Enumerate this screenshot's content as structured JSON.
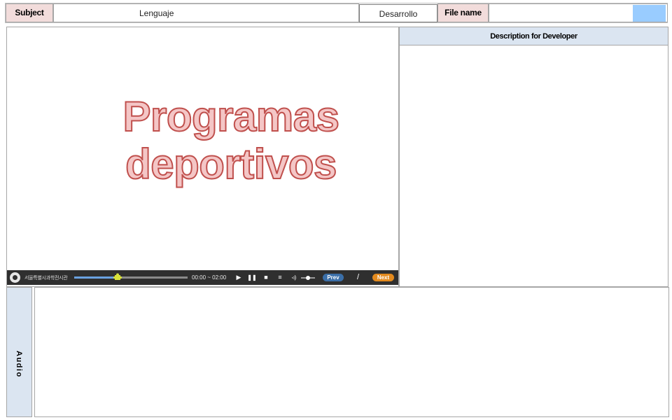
{
  "header": {
    "subject_label": "Subject",
    "subject_value": "Lenguaje",
    "category_value": "Desarrollo",
    "filename_label": "File name",
    "filename_value": ""
  },
  "slide": {
    "title_line1": "Programas",
    "title_line2": "deportivos"
  },
  "player": {
    "brand": "서울특별시과학전시관",
    "time": "00:00 ~ 02:00",
    "progress": 0.38,
    "volume": 0.5,
    "page_indicator": "/",
    "prev_label": "Prev",
    "next_label": "Next",
    "colors": {
      "bar": "#2f2f2f",
      "prev": "#3b6fa8",
      "next": "#e38a1e",
      "progress": "#6aa2e0",
      "handle": "#d8e23a"
    }
  },
  "description": {
    "header": "Description for Developer",
    "content": ""
  },
  "audio": {
    "label": "Audio",
    "content": ""
  },
  "colors": {
    "header_label_bg": "#f2dcdb",
    "panel_header_bg": "#dbe5f1",
    "filename_swatch": "#99ccff",
    "title_fill": "#f4c6c6",
    "title_stroke": "#c0504d"
  }
}
